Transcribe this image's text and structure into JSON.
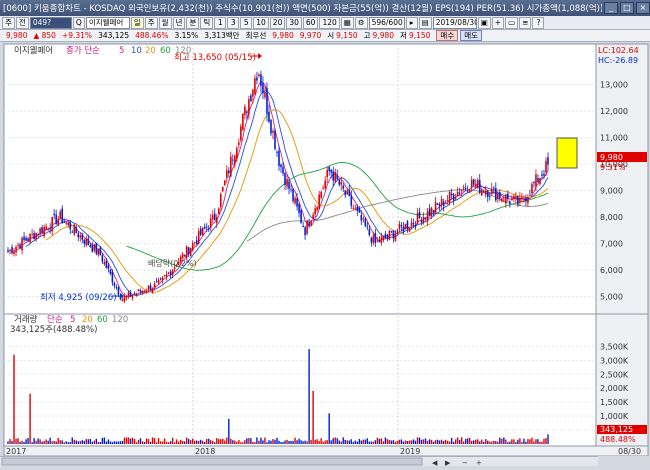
{
  "window": {
    "title": "[0600] 키움종합차트 - KOSDAQ 외국인보유(2,432(천)) 주식수(10,901(천)) 액면(500) 자본금(55(억)) 결산(12월) EPS(194) PER(51.36) 시가총액(1,088(억)) 유통비율(70.3)",
    "min_icon": "minimize-icon",
    "max_icon": "maximize-icon",
    "close_icon": "close-icon"
  },
  "toolbar": {
    "menu1": "주",
    "menu2": "전",
    "code_value": "049?",
    "stock_name": "이지웰페어",
    "period_buttons": [
      "일",
      "주",
      "월",
      "년",
      "분",
      "틱"
    ],
    "minute_buttons": [
      "1",
      "3",
      "5",
      "10",
      "20",
      "30",
      "60",
      "120"
    ],
    "count_value": "596/600",
    "date_value": "2019/08/30"
  },
  "infobar": {
    "price": "9,980",
    "change": "▲ 850",
    "change_pct": "+9.31%",
    "volume": "343,125",
    "vol_pct": "488.46%",
    "turnover": "3.15%",
    "amount": "3,313백만",
    "high_label": "최우선",
    "bid1": "9,980",
    "bid2": "9,970",
    "ask_label_s": "시",
    "open": "9,150",
    "high_label_g": "고",
    "high": "9,980",
    "low_label": "저",
    "low": "9,150",
    "buy_label": "매수",
    "sell_label": "매도"
  },
  "price_panel": {
    "legend_name": "이지웰페어",
    "legend_ma_label": "종가 단순",
    "legend_ma": [
      "5",
      "10",
      "20",
      "60",
      "120"
    ],
    "lc": "LC:102.64",
    "hc": "HC:-26.89",
    "last_price": "9,980",
    "last_pct": "9.31%",
    "max_label": "최고 13,650 (05/15)",
    "min_label": "최저 4,925 (09/26)",
    "dividend_label": "배당락(0.2%)",
    "y_ticks": [
      "13,000",
      "12,000",
      "11,000",
      "10,000",
      "9,000",
      "8,000",
      "7,000",
      "6,000",
      "5,000"
    ]
  },
  "volume_panel": {
    "legend_name": "거래량",
    "legend_ma_label": "단순",
    "legend_ma": [
      "5",
      "20",
      "60",
      "120"
    ],
    "current": "343,125주(488.48%)",
    "last_vol": "343,125",
    "last_vol_pct": "488.48%",
    "y_ticks": [
      "3,500K",
      "3,000K",
      "2,500K",
      "2,000K",
      "1,500K",
      "1,000K",
      "500,000"
    ]
  },
  "x_axis": {
    "labels": [
      "2017",
      "2018",
      "2019"
    ],
    "end_date": "08/30"
  },
  "chart_data": {
    "type": "candlestick",
    "title": "이지웰페어",
    "series": [
      {
        "name": "price",
        "type": "candlestick",
        "x_range": [
          "2017-01",
          "2019-08-30"
        ],
        "y_range": [
          4500,
          14000
        ]
      },
      {
        "name": "MA5"
      },
      {
        "name": "MA10"
      },
      {
        "name": "MA20"
      },
      {
        "name": "MA60"
      },
      {
        "name": "MA120"
      }
    ],
    "anchors": [
      {
        "date": "2017-01",
        "price": 6700
      },
      {
        "date": "2017-03",
        "price": 8000
      },
      {
        "date": "2017-06",
        "price": 6600
      },
      {
        "date": "2017-09-26",
        "price": 4925
      },
      {
        "date": "2017-12",
        "price": 5500
      },
      {
        "date": "2018-03",
        "price": 8000
      },
      {
        "date": "2018-05-15",
        "price": 13650
      },
      {
        "date": "2018-07",
        "price": 10000
      },
      {
        "date": "2018-09",
        "price": 7500
      },
      {
        "date": "2018-10",
        "price": 9800
      },
      {
        "date": "2019-01",
        "price": 7000
      },
      {
        "date": "2019-04",
        "price": 8200
      },
      {
        "date": "2019-05",
        "price": 9300
      },
      {
        "date": "2019-07",
        "price": 8500
      },
      {
        "date": "2019-08-30",
        "price": 9980
      }
    ],
    "last": {
      "close": 9980,
      "change": 850,
      "change_pct": 9.31,
      "volume": 343125
    },
    "volume_y_range": [
      0,
      3800000
    ]
  }
}
